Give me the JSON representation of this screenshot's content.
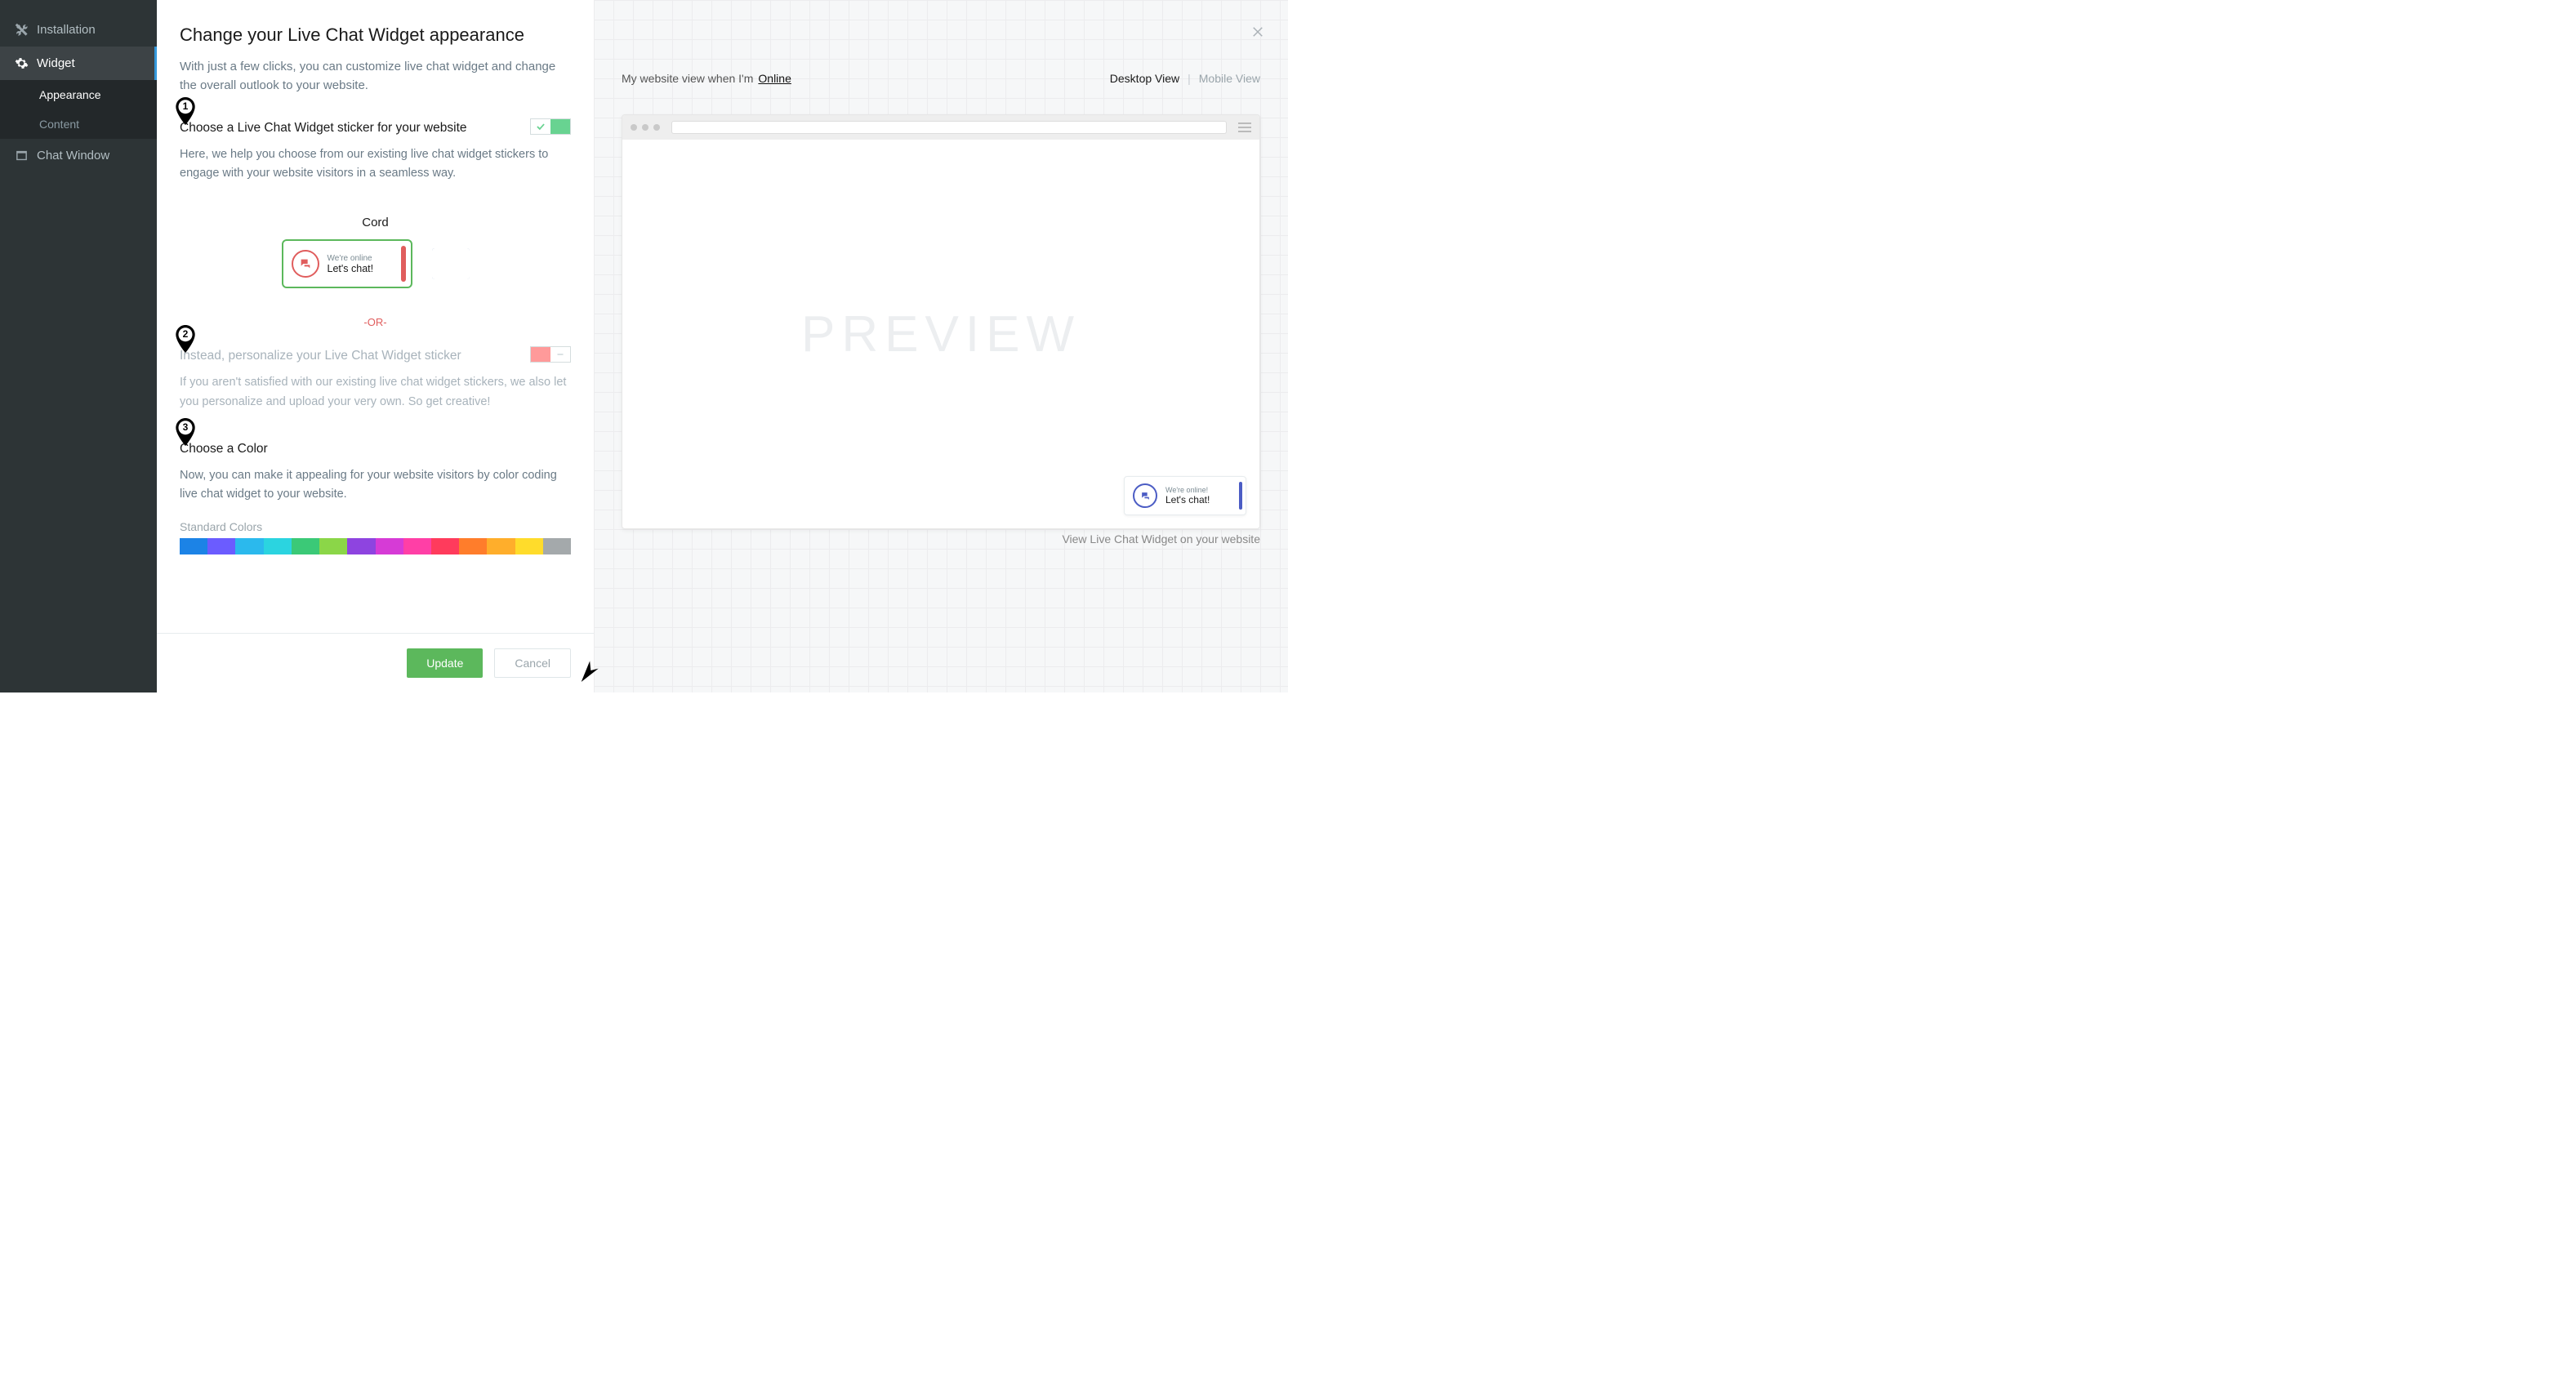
{
  "sidebar": {
    "items": [
      {
        "label": "Installation"
      },
      {
        "label": "Widget"
      },
      {
        "label": "Chat Window"
      }
    ],
    "sub_items": [
      {
        "label": "Appearance"
      },
      {
        "label": "Content"
      }
    ]
  },
  "settings": {
    "title": "Change your Live Chat Widget appearance",
    "intro": "With just a few clicks, you can customize live chat widget and change the overall outlook to your website.",
    "step1_title": "Choose a Live Chat Widget sticker for your website",
    "step1_desc": "Here, we help you choose from our existing live chat widget stickers to engage with your website visitors in a seamless way.",
    "sticker_name": "Cord",
    "sticker_online_label": "We're online",
    "sticker_cta": "Let's chat!",
    "or_text": "-OR-",
    "step2_title": "Instead, personalize your Live Chat Widget sticker",
    "step2_desc": "If you aren't satisfied with our existing live chat widget stickers, we also let you personalize and upload your very own. So get creative!",
    "step3_title": "Choose a Color",
    "step3_desc": "Now, you can make it appealing for your website visitors by color coding live chat widget to your website.",
    "colors_label": "Standard Colors",
    "colors": [
      "#1c83e6",
      "#6b5cff",
      "#2bb9ed",
      "#2bd4e0",
      "#3bc977",
      "#8bd648",
      "#8e44e0",
      "#d63bd6",
      "#ff3fa6",
      "#ff3b5c",
      "#ff7d2b",
      "#ffae2b",
      "#ffdc2b",
      "#a4a9ab"
    ],
    "update": "Update",
    "cancel": "Cancel"
  },
  "preview": {
    "prefix": "My website view when I'm",
    "status": "Online",
    "desktop": "Desktop View",
    "mobile": "Mobile View",
    "watermark": "PREVIEW",
    "widget_l1": "We're online!",
    "widget_l2": "Let's chat!",
    "footer_link": "View Live Chat Widget on your website"
  },
  "pins": {
    "one": "1",
    "two": "2",
    "three": "3"
  }
}
